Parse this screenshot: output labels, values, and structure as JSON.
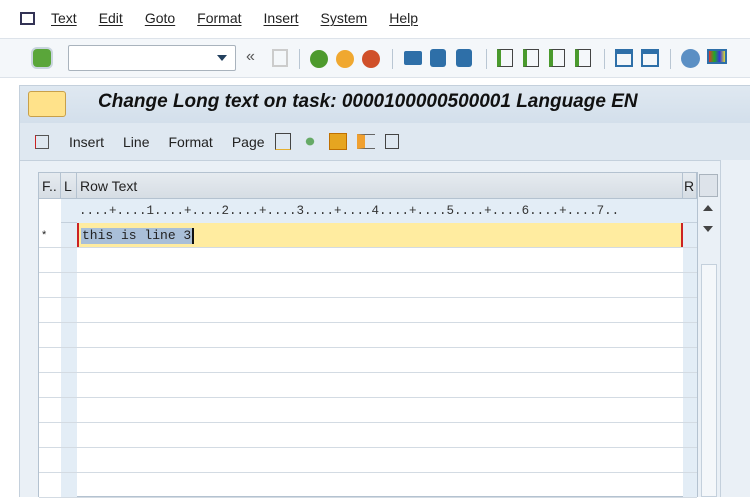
{
  "menubar": {
    "items": [
      "Text",
      "Edit",
      "Goto",
      "Format",
      "Insert",
      "System",
      "Help"
    ]
  },
  "toolbar": {
    "command_value": ""
  },
  "title": "Change Long text on task: 0000100000500001 Language EN",
  "app_toolbar": {
    "buttons": [
      "Insert",
      "Line",
      "Format",
      "Page"
    ]
  },
  "table": {
    "headers": [
      "F..",
      "L",
      "Row Text",
      "R"
    ],
    "ruler": "....+....1....+....2....+....3....+....4....+....5....+....6....+....7..",
    "rows": [
      {
        "flag": "*",
        "text": "this is line 3"
      }
    ]
  },
  "colors": {
    "highlight": "#ffeca0",
    "selection": "#a9bfd8",
    "accent": "#1f6fb5"
  }
}
